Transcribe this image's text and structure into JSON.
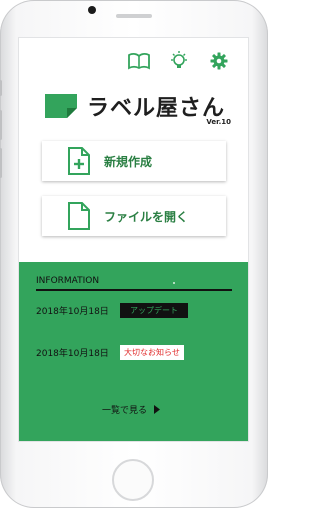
{
  "colors": {
    "accent": "#33a45c",
    "dark": "#111111",
    "alert": "#e12b2b"
  },
  "toolbar": {
    "icons": [
      "book-icon",
      "lightbulb-icon",
      "gear-icon"
    ]
  },
  "logo": {
    "title": "ラベル屋さん",
    "version": "Ver.10"
  },
  "menu": {
    "new_label": "新規作成",
    "open_label": "ファイルを開く"
  },
  "info": {
    "heading": "INFORMATION",
    "items": [
      {
        "date": "2018年10月18日",
        "badge": "アップデート"
      },
      {
        "date": "2018年10月18日",
        "badge": "大切なお知らせ"
      }
    ],
    "more_label": "一覧で見る"
  }
}
